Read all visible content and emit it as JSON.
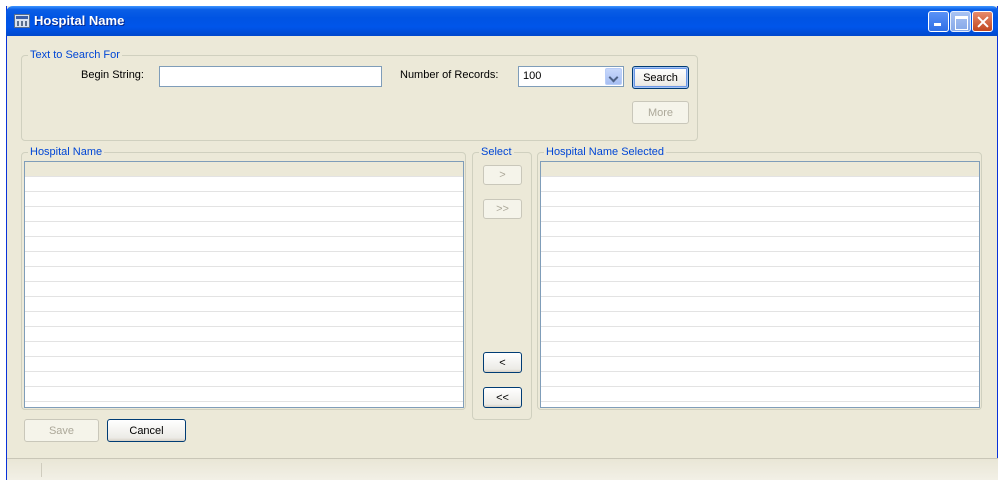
{
  "window": {
    "title": "Hospital Name"
  },
  "search_group": {
    "legend": "Text to Search For",
    "begin_label": "Begin String:",
    "begin_value": "",
    "records_label": "Number of Records:",
    "records_value": "100",
    "search_button": "Search",
    "more_button": "More"
  },
  "left_list": {
    "legend": "Hospital Name"
  },
  "select_group": {
    "legend": "Select",
    "move_one": ">",
    "move_all": ">>",
    "remove_one": "<",
    "remove_all": "<<"
  },
  "right_list": {
    "legend": "Hospital Name Selected"
  },
  "actions": {
    "save": "Save",
    "cancel": "Cancel"
  }
}
